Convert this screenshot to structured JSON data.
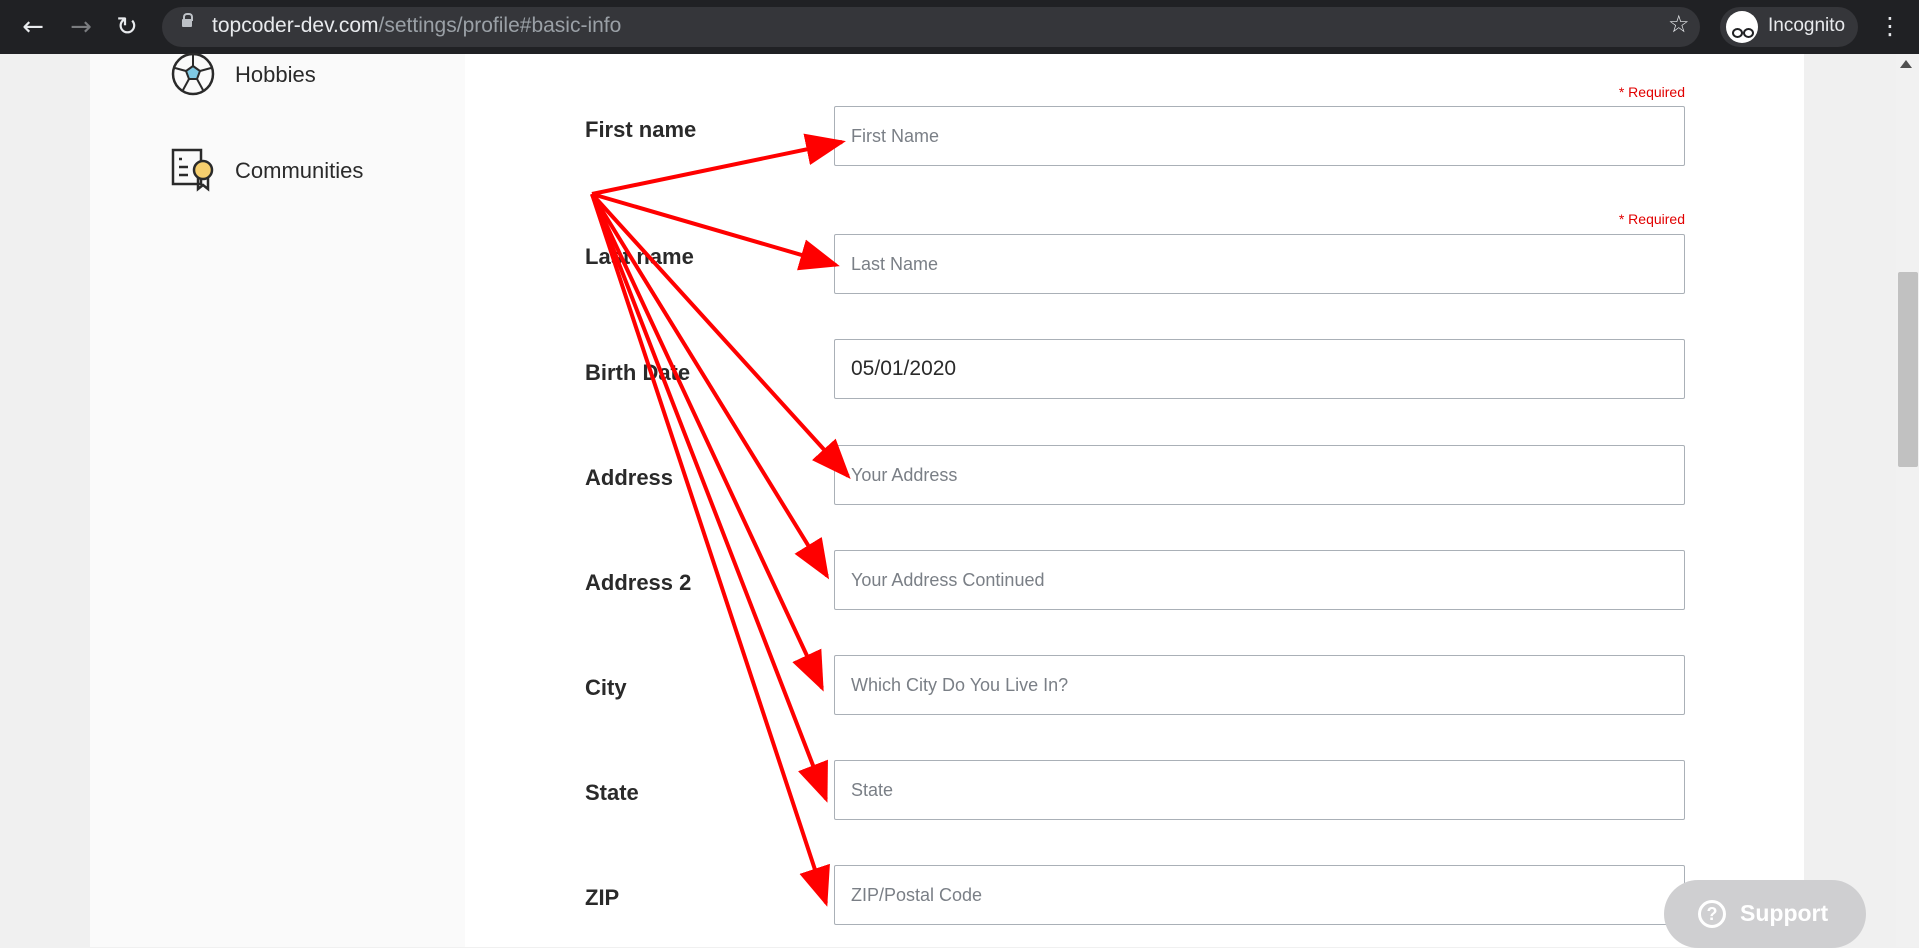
{
  "browser": {
    "url_host": "topcoder-dev.com",
    "url_path": "/settings/profile#basic-info",
    "profile_label": "Incognito",
    "icons": [
      "back-icon",
      "forward-icon",
      "reload-icon",
      "lock-icon",
      "star-icon",
      "incognito-icon",
      "menu-icon"
    ]
  },
  "sidebar": {
    "items": [
      {
        "label": "Hobbies",
        "icon": "hobbies-icon"
      },
      {
        "label": "Communities",
        "icon": "communities-icon"
      }
    ]
  },
  "form": {
    "required_text": "* Required",
    "fields": [
      {
        "label": "First name",
        "placeholder": "First Name",
        "value": "",
        "required": true
      },
      {
        "label": "Last name",
        "placeholder": "Last Name",
        "value": "",
        "required": true
      },
      {
        "label": "Birth Date",
        "placeholder": "",
        "value": "05/01/2020",
        "required": false
      },
      {
        "label": "Address",
        "placeholder": "Your Address",
        "value": "",
        "required": false
      },
      {
        "label": "Address 2",
        "placeholder": "Your Address Continued",
        "value": "",
        "required": false
      },
      {
        "label": "City",
        "placeholder": "Which City Do You Live In?",
        "value": "",
        "required": false
      },
      {
        "label": "State",
        "placeholder": "State",
        "value": "",
        "required": false
      },
      {
        "label": "ZIP",
        "placeholder": "ZIP/Postal Code",
        "value": "",
        "required": false
      }
    ]
  },
  "support": {
    "label": "Support"
  },
  "annotation": {
    "color": "#ff0000"
  }
}
